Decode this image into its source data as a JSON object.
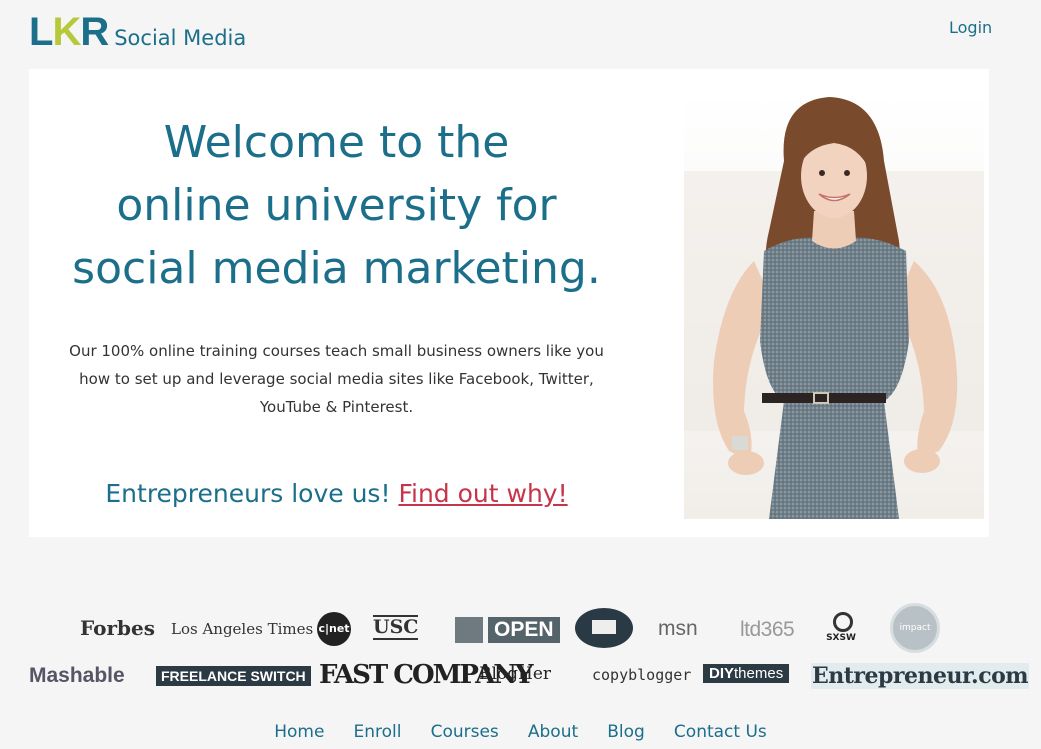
{
  "header": {
    "logo_mark": [
      "L",
      "K",
      "R"
    ],
    "logo_text": "Social Media",
    "login_label": "Login"
  },
  "hero": {
    "headline_lines": [
      "Welcome to the",
      "online university for",
      "social media marketing."
    ],
    "description": "Our 100% online training courses teach small business owners like you how to set up and leverage social media sites like Facebook, Twitter, YouTube & Pinterest.",
    "love_text": "Entrepreneurs love us!",
    "love_link": "Find out why!"
  },
  "press": {
    "forbes": "Forbes",
    "latimes": "Los Angeles Times",
    "cnet": "c|net",
    "usc": "USC",
    "open": "OPEN",
    "msn": "msn",
    "ltd365": "ltd365",
    "sxsw": "SXSW",
    "impact": "impact",
    "mashable": "Mashable",
    "freelance": "FREELANCE SWITCH",
    "fastco": "FAST COMPANY",
    "blogher": "BlogHer",
    "copyblogger": "copyblogger",
    "diy_bold": "DIY",
    "diy_rest": "themes",
    "entrepreneur": "Entrepreneur.com"
  },
  "footer_nav": [
    "Home",
    "Enroll",
    "Courses",
    "About",
    "Blog",
    "Contact Us"
  ]
}
